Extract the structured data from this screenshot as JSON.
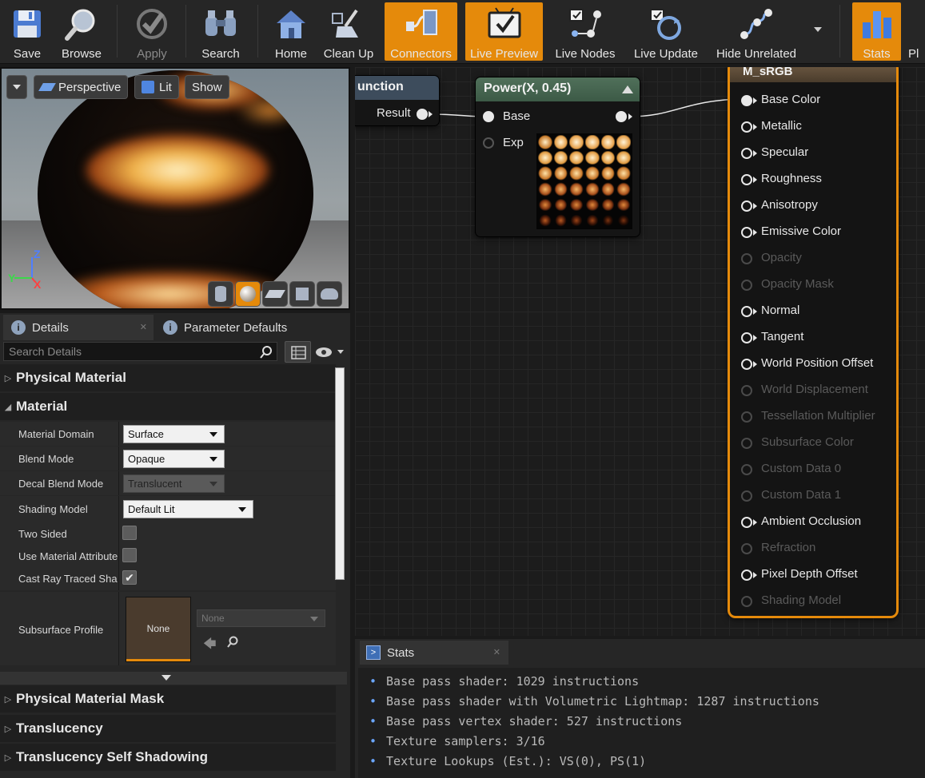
{
  "toolbar": {
    "buttons": [
      {
        "label": "Save",
        "icon": "save-icon",
        "active": false,
        "disabled": false
      },
      {
        "label": "Browse",
        "icon": "browse-icon",
        "active": false,
        "disabled": false
      },
      {
        "label": "Apply",
        "icon": "apply-checkmark-icon",
        "active": false,
        "disabled": true
      },
      {
        "label": "Search",
        "icon": "binoculars-icon",
        "active": false,
        "disabled": false
      },
      {
        "label": "Home",
        "icon": "home-icon",
        "active": false,
        "disabled": false
      },
      {
        "label": "Clean Up",
        "icon": "broom-icon",
        "active": false,
        "disabled": false
      },
      {
        "label": "Connectors",
        "icon": "connectors-icon",
        "active": true,
        "disabled": false
      },
      {
        "label": "Live Preview",
        "icon": "live-preview-icon",
        "active": true,
        "disabled": false
      },
      {
        "label": "Live Nodes",
        "icon": "live-nodes-icon",
        "active": false,
        "disabled": false
      },
      {
        "label": "Live Update",
        "icon": "live-update-icon",
        "active": false,
        "disabled": false
      },
      {
        "label": "Hide Unrelated",
        "icon": "hide-unrelated-icon",
        "active": false,
        "disabled": false
      },
      {
        "label": "Stats",
        "icon": "stats-icon",
        "active": true,
        "disabled": false
      },
      {
        "label": "Pl",
        "icon": "platform-icon",
        "active": false,
        "disabled": false
      }
    ],
    "accent_color": "#e58a0b"
  },
  "viewport": {
    "perspective_label": "Perspective",
    "lit_label": "Lit",
    "show_label": "Show",
    "axis_z": "Z",
    "axis_y": "Y",
    "axis_x": "X",
    "preview_shapes": [
      "cylinder-icon",
      "sphere-icon",
      "plane-icon",
      "cube-icon",
      "teapot-icon"
    ]
  },
  "details": {
    "tabs": [
      {
        "label": "Details",
        "icon": "info-icon"
      },
      {
        "label": "Parameter Defaults",
        "icon": "info-icon"
      }
    ],
    "search_placeholder": "Search Details",
    "categories": {
      "physical_material": "Physical Material",
      "material": "Material",
      "physical_material_mask": "Physical Material Mask",
      "translucency": "Translucency",
      "translucency_self_shadowing": "Translucency Self Shadowing"
    },
    "properties": {
      "material_domain": {
        "name": "Material Domain",
        "value": "Surface"
      },
      "blend_mode": {
        "name": "Blend Mode",
        "value": "Opaque"
      },
      "decal_blend_mode": {
        "name": "Decal Blend Mode",
        "value": "Translucent"
      },
      "shading_model": {
        "name": "Shading Model",
        "value": "Default Lit"
      },
      "two_sided": {
        "name": "Two Sided",
        "checked": false
      },
      "use_material_attributes": {
        "name": "Use Material Attributes",
        "checked": false
      },
      "cast_ray_traced_shadows": {
        "name": "Cast Ray Traced Shadows",
        "checked": true
      },
      "subsurface_profile": {
        "name": "Subsurface Profile",
        "thumb": "None",
        "value": "None"
      }
    }
  },
  "graph": {
    "function_node": {
      "title": "unction",
      "output": "Result"
    },
    "power_node": {
      "title": "Power(X, 0.45)",
      "inputs": [
        "Base",
        "Exp"
      ]
    },
    "material_node": {
      "title": "M_sRGB",
      "pins": [
        {
          "label": "Base Color",
          "enabled": true,
          "connected": true
        },
        {
          "label": "Metallic",
          "enabled": true,
          "connected": false
        },
        {
          "label": "Specular",
          "enabled": true,
          "connected": false
        },
        {
          "label": "Roughness",
          "enabled": true,
          "connected": false
        },
        {
          "label": "Anisotropy",
          "enabled": true,
          "connected": false
        },
        {
          "label": "Emissive Color",
          "enabled": true,
          "connected": false
        },
        {
          "label": "Opacity",
          "enabled": false,
          "connected": false
        },
        {
          "label": "Opacity Mask",
          "enabled": false,
          "connected": false
        },
        {
          "label": "Normal",
          "enabled": true,
          "connected": false
        },
        {
          "label": "Tangent",
          "enabled": true,
          "connected": false
        },
        {
          "label": "World Position Offset",
          "enabled": true,
          "connected": false
        },
        {
          "label": "World Displacement",
          "enabled": false,
          "connected": false
        },
        {
          "label": "Tessellation Multiplier",
          "enabled": false,
          "connected": false
        },
        {
          "label": "Subsurface Color",
          "enabled": false,
          "connected": false
        },
        {
          "label": "Custom Data 0",
          "enabled": false,
          "connected": false
        },
        {
          "label": "Custom Data 1",
          "enabled": false,
          "connected": false
        },
        {
          "label": "Ambient Occlusion",
          "enabled": true,
          "connected": false
        },
        {
          "label": "Refraction",
          "enabled": false,
          "connected": false
        },
        {
          "label": "Pixel Depth Offset",
          "enabled": true,
          "connected": false
        },
        {
          "label": "Shading Model",
          "enabled": false,
          "connected": false
        }
      ]
    }
  },
  "stats": {
    "tab_label": "Stats",
    "lines": [
      "Base pass shader: 1029 instructions",
      "Base pass shader with Volumetric Lightmap: 1287 instructions",
      "Base pass vertex shader: 527 instructions",
      "Texture samplers: 3/16",
      "Texture Lookups (Est.): VS(0), PS(1)"
    ]
  }
}
